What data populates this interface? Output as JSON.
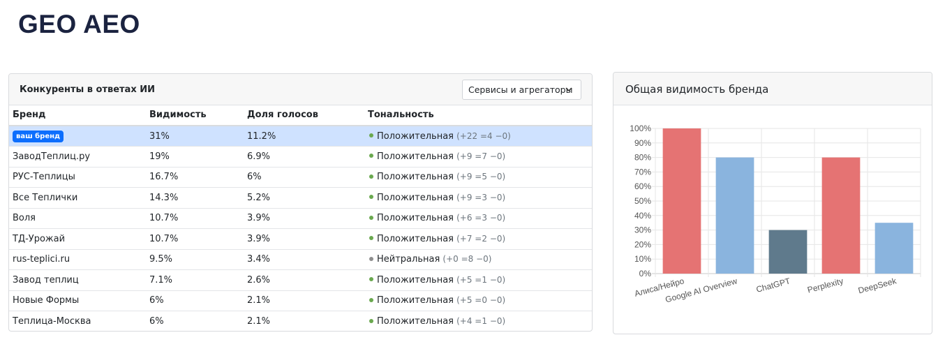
{
  "page": {
    "title": "GEO AEO"
  },
  "competitors": {
    "title": "Конкуренты в ответах ИИ",
    "filter": {
      "selected": "Сервисы и агрегаторы",
      "icon": "chevron-down-icon"
    },
    "columns": [
      "Бренд",
      "Видимость",
      "Доля голосов",
      "Тональность"
    ],
    "rows": [
      {
        "brand": "ваш бренд",
        "is_own": true,
        "visibility": "31%",
        "share": "11.2%",
        "tone": "Положительная",
        "tone_type": "positive",
        "counts": "(+22 =4 −0)"
      },
      {
        "brand": "ЗаводТеплиц.ру",
        "visibility": "19%",
        "share": "6.9%",
        "tone": "Положительная",
        "tone_type": "positive",
        "counts": "(+9 =7 −0)"
      },
      {
        "brand": "РУС-Теплицы",
        "visibility": "16.7%",
        "share": "6%",
        "tone": "Положительная",
        "tone_type": "positive",
        "counts": "(+9 =5 −0)"
      },
      {
        "brand": "Все Теплички",
        "visibility": "14.3%",
        "share": "5.2%",
        "tone": "Положительная",
        "tone_type": "positive",
        "counts": "(+9 =3 −0)"
      },
      {
        "brand": "Воля",
        "visibility": "10.7%",
        "share": "3.9%",
        "tone": "Положительная",
        "tone_type": "positive",
        "counts": "(+6 =3 −0)"
      },
      {
        "brand": "ТД-Урожай",
        "visibility": "10.7%",
        "share": "3.9%",
        "tone": "Положительная",
        "tone_type": "positive",
        "counts": "(+7 =2 −0)"
      },
      {
        "brand": "rus-teplici.ru",
        "visibility": "9.5%",
        "share": "3.4%",
        "tone": "Нейтральная",
        "tone_type": "neutral",
        "counts": "(+0 =8 −0)"
      },
      {
        "brand": "Завод теплиц",
        "visibility": "7.1%",
        "share": "2.6%",
        "tone": "Положительная",
        "tone_type": "positive",
        "counts": "(+5 =1 −0)"
      },
      {
        "brand": "Новые Формы",
        "visibility": "6%",
        "share": "2.1%",
        "tone": "Положительная",
        "tone_type": "positive",
        "counts": "(+5 =0 −0)"
      },
      {
        "brand": "Теплица-Москва",
        "visibility": "6%",
        "share": "2.1%",
        "tone": "Положительная",
        "tone_type": "positive",
        "counts": "(+4 =1 −0)"
      }
    ],
    "colors": {
      "highlight": "#cfe2ff",
      "badge": "#0d6efd",
      "positive": "#6aa84f",
      "neutral": "#8e8e8e"
    }
  },
  "visibility": {
    "title": "Общая видимость бренда"
  },
  "chart_data": {
    "type": "bar",
    "title": "Общая видимость бренда",
    "categories": [
      "Алиса/Нейро",
      "Google AI Overview",
      "ChatGPT",
      "Perplexity",
      "DeepSeek"
    ],
    "values": [
      100,
      80,
      30,
      80,
      35
    ],
    "colors": [
      "#e57373",
      "#8ab4de",
      "#5f7a8c",
      "#e57373",
      "#8ab4de"
    ],
    "ylim": [
      0,
      100
    ],
    "y_ticks": [
      "0%",
      "10%",
      "20%",
      "30%",
      "40%",
      "50%",
      "60%",
      "70%",
      "80%",
      "90%",
      "100%"
    ],
    "grid": true,
    "legend": "none",
    "xlabel": "",
    "ylabel": ""
  }
}
